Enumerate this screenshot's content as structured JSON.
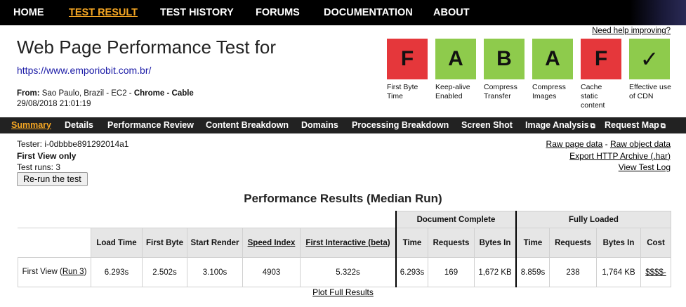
{
  "nav": {
    "home": "HOME",
    "test_result": "TEST RESULT",
    "test_history": "TEST HISTORY",
    "forums": "FORUMS",
    "documentation": "DOCUMENTATION",
    "about": "ABOUT"
  },
  "header": {
    "title": "Web Page Performance Test for",
    "url": "https://www.emporiobit.com.br/",
    "from_label": "From:",
    "location": "Sao Paulo, Brazil - EC2 -",
    "browser": "Chrome - Cable",
    "datetime": "29/08/2018 21:01:19",
    "help_link": "Need help improving?"
  },
  "grades": [
    {
      "letter": "F",
      "label": "First Byte Time",
      "color": "#e5373b"
    },
    {
      "letter": "A",
      "label": "Keep-alive Enabled",
      "color": "#8ecb4c"
    },
    {
      "letter": "B",
      "label": "Compress Transfer",
      "color": "#8ecb4c"
    },
    {
      "letter": "A",
      "label": "Compress Images",
      "color": "#8ecb4c"
    },
    {
      "letter": "F",
      "label": "Cache static content",
      "color": "#e5373b"
    },
    {
      "letter": "✓",
      "label": "Effective use of CDN",
      "color": "#8ecb4c"
    }
  ],
  "subnav": {
    "summary": "Summary",
    "details": "Details",
    "performance_review": "Performance Review",
    "content_breakdown": "Content Breakdown",
    "domains": "Domains",
    "processing_breakdown": "Processing Breakdown",
    "screen_shot": "Screen Shot",
    "image_analysis": "Image Analysis",
    "request_map": "Request Map",
    "external_icon": "⧉"
  },
  "meta": {
    "tester": "Tester: i-0dbbbe891292014a1",
    "first_view_only": "First View only",
    "test_runs": "Test runs: 3",
    "rerun_button": "Re-run the test"
  },
  "right_links": {
    "raw_page": "Raw page data",
    "separator": " - ",
    "raw_object": "Raw object data",
    "export_har": "Export HTTP Archive (.har)",
    "view_log": "View Test Log"
  },
  "results": {
    "title": "Performance Results (Median Run)",
    "group_document": "Document Complete",
    "group_fully": "Fully Loaded",
    "headers": {
      "load_time": "Load Time",
      "first_byte": "First Byte",
      "start_render": "Start Render",
      "speed_index": "Speed Index",
      "first_interactive": "First Interactive (beta)",
      "doc_time": "Time",
      "doc_requests": "Requests",
      "doc_bytes": "Bytes In",
      "full_time": "Time",
      "full_requests": "Requests",
      "full_bytes": "Bytes In",
      "cost": "Cost"
    },
    "row": {
      "label": "First View (",
      "run_link": "Run 3",
      "label_end": ")",
      "load_time": "6.293s",
      "first_byte": "2.502s",
      "start_render": "3.100s",
      "speed_index": "4903",
      "first_interactive": "5.322s",
      "doc_time": "6.293s",
      "doc_requests": "169",
      "doc_bytes": "1,672 KB",
      "full_time": "8.859s",
      "full_requests": "238",
      "full_bytes": "1,764 KB",
      "cost": "$$$$-"
    },
    "plot_link": "Plot Full Results"
  }
}
